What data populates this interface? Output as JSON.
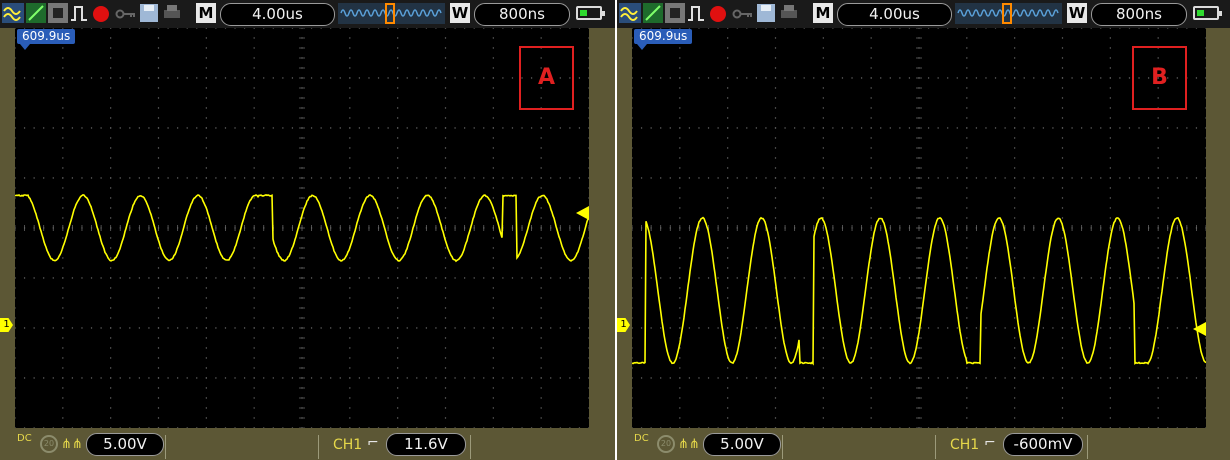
{
  "scopes": [
    {
      "id": "a",
      "panel_label": "A",
      "timebase_mode": "M",
      "timebase": "4.00us",
      "window_mode": "W",
      "window_timebase": "800ns",
      "trigger_time_badge": "609.9us",
      "ground_marker_label": "1",
      "bottom": {
        "coupling": "DC",
        "volts_per_div": "5.00V",
        "channel": "CH1",
        "trigger_level": "11.6V"
      },
      "waveform": {
        "baseline_div": 2.0,
        "amplitude_div": 0.65,
        "period_div": 0.6,
        "flat_top_div": 2.55
      }
    },
    {
      "id": "b",
      "panel_label": "B",
      "timebase_mode": "M",
      "timebase": "4.00us",
      "window_mode": "W",
      "window_timebase": "800ns",
      "trigger_time_badge": "609.9us",
      "ground_marker_label": "1",
      "bottom": {
        "coupling": "DC",
        "volts_per_div": "5.00V",
        "channel": "CH1",
        "trigger_level": "-600mV"
      },
      "waveform": {
        "baseline_div": 0.75,
        "amplitude_div": 1.45,
        "period_div": 0.62,
        "flat_top_div": 1.75
      }
    }
  ],
  "colors": {
    "trace": "#ffff00",
    "grid": "#666666",
    "battery": "#2fdb2f",
    "panel_label": "#e02020"
  }
}
